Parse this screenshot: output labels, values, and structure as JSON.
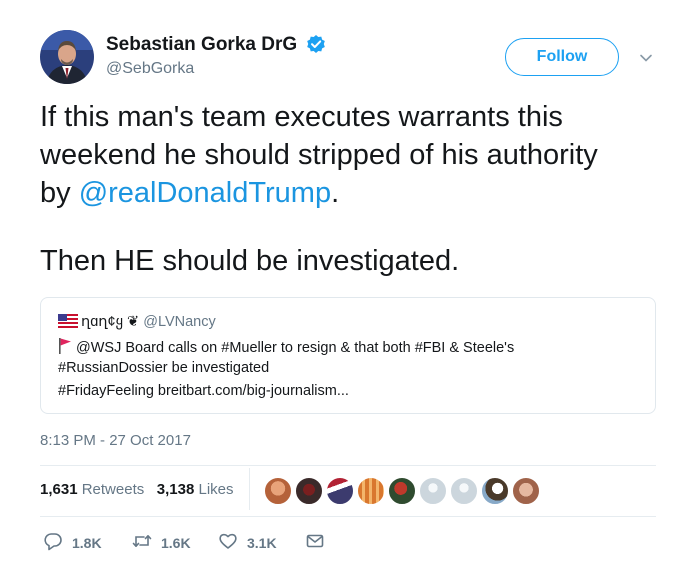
{
  "author": {
    "display_name": "Sebastian Gorka DrG",
    "handle": "@SebGorka",
    "verified": true
  },
  "follow_button": {
    "label": "Follow"
  },
  "tweet": {
    "line1": "If this man's team executes warrants this",
    "line2": "weekend he should stripped of his authority",
    "line3_prefix": "by ",
    "line3_mention": "@realDonaldTrump",
    "line3_suffix": ".",
    "line4": "Then HE should be investigated."
  },
  "quoted_tweet": {
    "name": "ղɑղ¢ყ ❦",
    "handle": "@LVNancy",
    "line1": "@WSJ Board calls on #Mueller to resign & that both #FBI & Steele's",
    "line2": "#RussianDossier be investigated",
    "line3": "#FridayFeeling breitbart.com/big-journalism..."
  },
  "timestamp": "8:13 PM - 27 Oct 2017",
  "stats": {
    "retweets_count": "1,631",
    "retweets_label": "Retweets",
    "likes_count": "3,138",
    "likes_label": "Likes"
  },
  "actions": {
    "reply_count": "1.8K",
    "retweet_count": "1.6K",
    "like_count": "3.1K"
  },
  "colors": {
    "accent": "#1da1f2",
    "mention": "#1b95e0",
    "muted_text": "#657786",
    "border": "#e1e8ed"
  },
  "icons": [
    "verified-badge-icon",
    "chevron-down-icon",
    "us-flag-icon",
    "red-flag-icon",
    "reply-icon",
    "retweet-icon",
    "like-icon",
    "direct-message-icon"
  ]
}
